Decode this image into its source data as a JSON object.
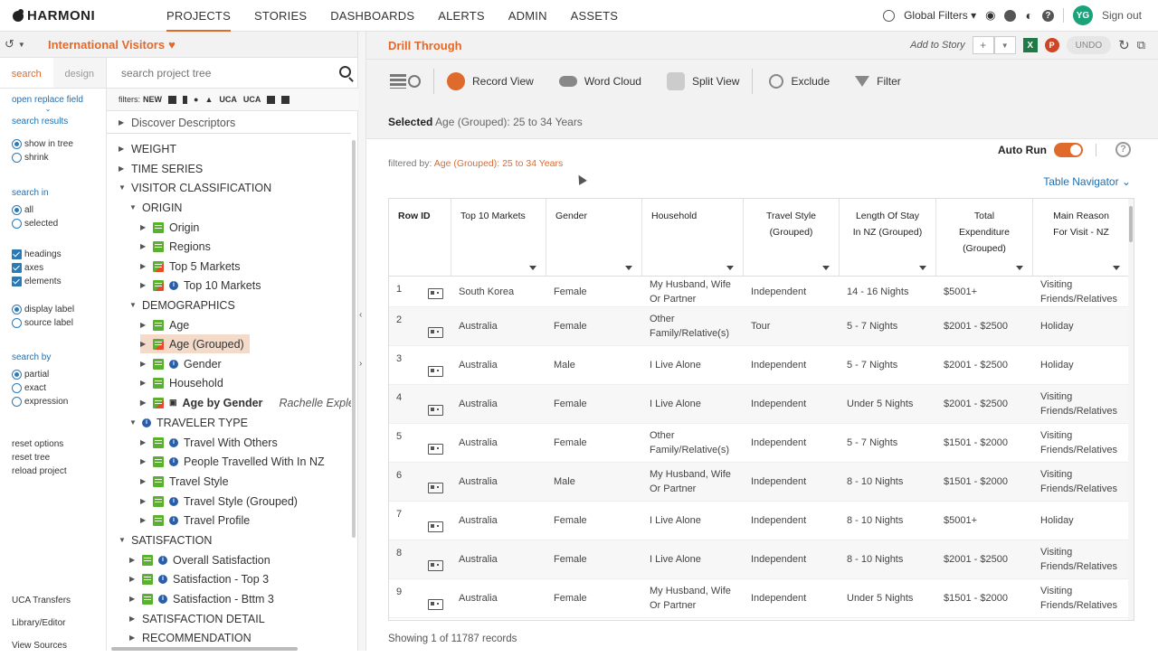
{
  "app": {
    "logo": "HARMONI"
  },
  "nav": [
    "PROJECTS",
    "STORIES",
    "DASHBOARDS",
    "ALERTS",
    "ADMIN",
    "ASSETS"
  ],
  "top_right": {
    "global_filters": "Global Filters ▾",
    "avatar": "YG",
    "signout": "Sign out"
  },
  "project": {
    "title": "International Visitors"
  },
  "left": {
    "tabs": [
      "search",
      "design"
    ],
    "open_replace": "open replace field",
    "search_results": "search results",
    "show_in_tree": "show in tree",
    "shrink": "shrink",
    "search_in": "search in",
    "all": "all",
    "selected": "selected",
    "headings": "headings",
    "axes": "axes",
    "elements": "elements",
    "display_label": "display label",
    "source_label": "source label",
    "search_by": "search by",
    "partial": "partial",
    "exact": "exact",
    "expression": "expression",
    "reset_options": "reset options",
    "reset_tree": "reset tree",
    "reload_project": "reload project",
    "uca_transfers": "UCA Transfers",
    "library_editor": "Library/Editor",
    "view_sources": "View Sources"
  },
  "tree": {
    "search_placeholder": "search project tree",
    "filters_label": "filters:",
    "filters_new": "NEW",
    "uca1": "UCA",
    "uca2": "UCA",
    "nodes": [
      {
        "label": "Discover Descriptors"
      },
      {
        "label": "WEIGHT"
      },
      {
        "label": "TIME SERIES"
      },
      {
        "label": "VISITOR CLASSIFICATION"
      },
      {
        "label": "ORIGIN"
      },
      {
        "label": "Origin"
      },
      {
        "label": "Regions"
      },
      {
        "label": "Top 5 Markets"
      },
      {
        "label": "Top 10 Markets"
      },
      {
        "label": "DEMOGRAPHICS"
      },
      {
        "label": "Age"
      },
      {
        "label": "Age (Grouped)"
      },
      {
        "label": "Gender"
      },
      {
        "label": "Household"
      },
      {
        "label": "Age by Gender",
        "extra": "Rachelle Exple"
      },
      {
        "label": "TRAVELER TYPE"
      },
      {
        "label": "Travel With Others"
      },
      {
        "label": "People Travelled With In NZ"
      },
      {
        "label": "Travel Style"
      },
      {
        "label": "Travel Style (Grouped)"
      },
      {
        "label": "Travel Profile"
      },
      {
        "label": "SATISFACTION"
      },
      {
        "label": "Overall Satisfaction"
      },
      {
        "label": "Satisfaction - Top 3"
      },
      {
        "label": "Satisfaction - Bttm 3"
      },
      {
        "label": "SATISFACTION DETAIL"
      },
      {
        "label": "RECOMMENDATION"
      }
    ]
  },
  "main": {
    "title": "Drill Through",
    "add_to_story": "Add to Story",
    "undo": "UNDO",
    "toolbar": [
      "Record View",
      "Word Cloud",
      "Split View",
      "Exclude",
      "Filter"
    ],
    "selected_label": "Selected",
    "selected_value": "Age (Grouped): 25 to 34 Years",
    "filtered_by_label": "filtered by:",
    "filtered_by_value": "Age (Grouped): 25 to 34 Years",
    "auto_run": "Auto Run",
    "table_navigator": "Table Navigator ⌄",
    "footer": "Showing 1 of 11787 records",
    "columns": [
      "Row ID",
      "Top 10 Markets",
      "Gender",
      "Household",
      "Travel Style\n(Grouped)",
      "Length Of Stay\nIn NZ (Grouped)",
      "Total\nExpenditure\n(Grouped)",
      "Main Reason\nFor Visit - NZ"
    ],
    "rows": [
      [
        "1",
        "South Korea",
        "Female",
        "My Husband, Wife\nOr Partner",
        "Independent",
        "14 - 16 Nights",
        "$5001+",
        "Visiting\nFriends/Relatives"
      ],
      [
        "2",
        "Australia",
        "Female",
        "Other\nFamily/Relative(s)",
        "Tour",
        "5 - 7 Nights",
        "$2001 - $2500",
        "Holiday"
      ],
      [
        "3",
        "Australia",
        "Male",
        "I Live Alone",
        "Independent",
        "5 - 7 Nights",
        "$2001 - $2500",
        "Holiday"
      ],
      [
        "4",
        "Australia",
        "Female",
        "I Live Alone",
        "Independent",
        "Under 5 Nights",
        "$2001 - $2500",
        "Visiting\nFriends/Relatives"
      ],
      [
        "5",
        "Australia",
        "Female",
        "Other\nFamily/Relative(s)",
        "Independent",
        "5 - 7 Nights",
        "$1501 - $2000",
        "Visiting\nFriends/Relatives"
      ],
      [
        "6",
        "Australia",
        "Male",
        "My Husband, Wife\nOr Partner",
        "Independent",
        "8 - 10 Nights",
        "$1501 - $2000",
        "Visiting\nFriends/Relatives"
      ],
      [
        "7",
        "Australia",
        "Female",
        "I Live Alone",
        "Independent",
        "8 - 10 Nights",
        "$5001+",
        "Holiday"
      ],
      [
        "8",
        "Australia",
        "Female",
        "I Live Alone",
        "Independent",
        "8 - 10 Nights",
        "$2001 - $2500",
        "Visiting\nFriends/Relatives"
      ],
      [
        "9",
        "Australia",
        "Female",
        "My Husband, Wife\nOr Partner",
        "Independent",
        "Under 5 Nights",
        "$1501 - $2000",
        "Visiting\nFriends/Relatives"
      ]
    ]
  }
}
